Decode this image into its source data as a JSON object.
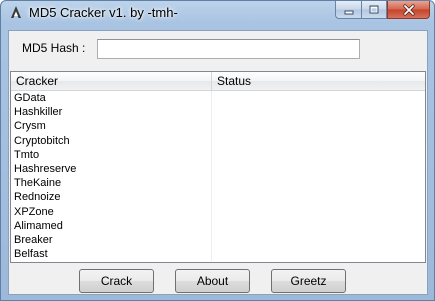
{
  "window": {
    "title": "MD5 Cracker v1. by -tmh-"
  },
  "form": {
    "hash_label": "MD5 Hash :",
    "hash_value": ""
  },
  "list": {
    "columns": [
      "Cracker",
      "Status"
    ],
    "rows": [
      {
        "name": "GData",
        "status": ""
      },
      {
        "name": "Hashkiller",
        "status": ""
      },
      {
        "name": "Crysm",
        "status": ""
      },
      {
        "name": "Cryptobitch",
        "status": ""
      },
      {
        "name": "Tmto",
        "status": ""
      },
      {
        "name": "Hashreserve",
        "status": ""
      },
      {
        "name": "TheKaine",
        "status": ""
      },
      {
        "name": "Rednoize",
        "status": ""
      },
      {
        "name": "XPZone",
        "status": ""
      },
      {
        "name": "Alimamed",
        "status": ""
      },
      {
        "name": "Breaker",
        "status": ""
      },
      {
        "name": "Belfast",
        "status": ""
      }
    ]
  },
  "buttons": {
    "crack": "Crack",
    "about": "About",
    "greetz": "Greetz"
  },
  "icons": {
    "app": "app-icon",
    "minimize": "minimize-icon",
    "maximize": "maximize-icon",
    "close": "close-icon"
  }
}
